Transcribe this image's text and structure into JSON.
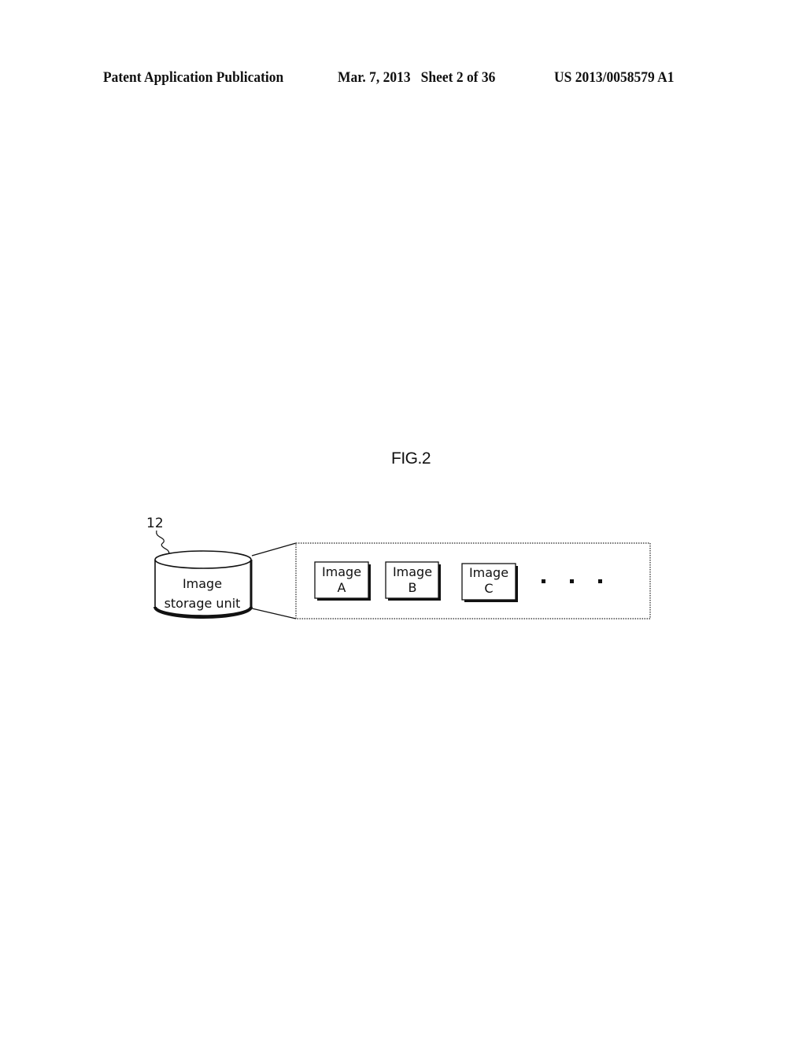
{
  "header": {
    "publication_type": "Patent Application Publication",
    "date_sheet": "Mar. 7, 2013   Sheet 2 of 36",
    "publication_number": "US 2013/0058579 A1"
  },
  "figure": {
    "title": "FIG.2",
    "storage": {
      "reference_numeral": "12",
      "label_line1": "Image",
      "label_line2": "storage unit",
      "icon": "database-cylinder-icon"
    },
    "images": [
      {
        "line1": "Image",
        "line2": "A"
      },
      {
        "line1": "Image",
        "line2": "B"
      },
      {
        "line1": "Image",
        "line2": "C"
      }
    ],
    "continuation": "..."
  }
}
